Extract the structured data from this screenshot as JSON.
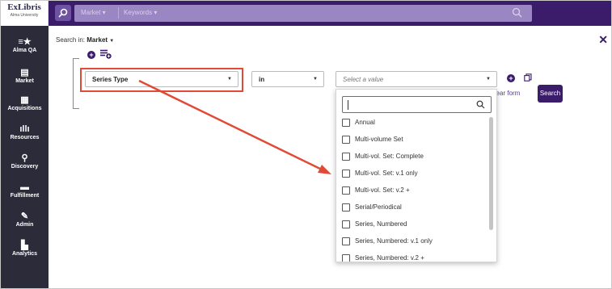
{
  "logo": {
    "main": "ExLibris",
    "sub": "Alma University"
  },
  "sidebar": {
    "items": [
      {
        "label": "Alma QA",
        "icon": "list-star-icon",
        "glyph": "≡★"
      },
      {
        "label": "Market",
        "icon": "market-icon",
        "glyph": "▤"
      },
      {
        "label": "Acquisitions",
        "icon": "acquisitions-icon",
        "glyph": "▦"
      },
      {
        "label": "Resources",
        "icon": "resources-icon",
        "glyph": "ıllı"
      },
      {
        "label": "Discovery",
        "icon": "telescope-icon",
        "glyph": "⚲"
      },
      {
        "label": "Fulfillment",
        "icon": "fulfillment-icon",
        "glyph": "▬"
      },
      {
        "label": "Admin",
        "icon": "wrench-icon",
        "glyph": "✎"
      },
      {
        "label": "Analytics",
        "icon": "analytics-icon",
        "glyph": "▙"
      }
    ]
  },
  "topbar": {
    "scope1": "Market ▾",
    "scope2": "Keywords ▾"
  },
  "main": {
    "search_in_label": "Search in:",
    "search_in_value": "Market",
    "close": "✕",
    "field": "Series Type",
    "operator": "in",
    "value_placeholder": "Select a value",
    "clear_form": "Clear form",
    "search_button": "Search"
  },
  "dropdown": {
    "options": [
      "Annual",
      "Multi-volume Set",
      "Multi-vol. Set: Complete",
      "Multi-vol. Set: v.1 only",
      "Multi-vol. Set: v.2 +",
      "Serial/Periodical",
      "Series, Numbered",
      "Series, Numbered: v.1 only",
      "Series, Numbered: v.2 +"
    ]
  },
  "colors": {
    "brand": "#3b1c6b",
    "sidebar": "#2b2b3a",
    "annotation": "#e04a36"
  }
}
